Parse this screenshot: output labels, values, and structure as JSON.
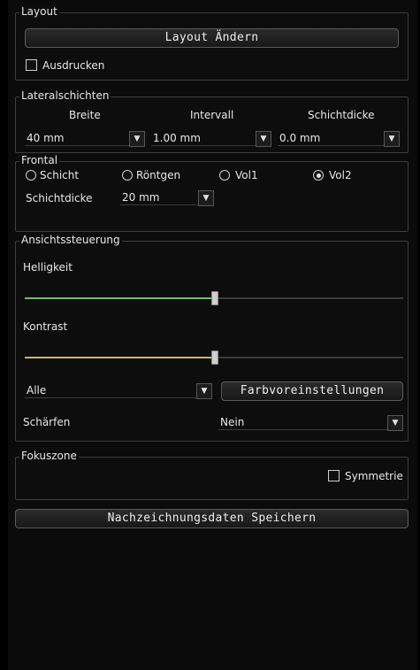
{
  "layout": {
    "title": "Layout",
    "change_button": "Layout Ändern",
    "print_label": "Ausdrucken",
    "print_checked": false
  },
  "lateral": {
    "title": "Lateralschichten",
    "headers": [
      "Breite",
      "Intervall",
      "Schichtdicke"
    ],
    "values": [
      "40 mm",
      "1.00 mm",
      "0.0 mm"
    ]
  },
  "frontal": {
    "title": "Frontal",
    "options": [
      "Schicht",
      "Röntgen",
      "Vol1",
      "Vol2"
    ],
    "selected": "Vol2",
    "thickness_label": "Schichtdicke",
    "thickness_value": "20 mm"
  },
  "view": {
    "title": "Ansichtssteuerung",
    "brightness_label": "Helligkeit",
    "brightness_value": 0.5,
    "brightness_color": "#78b878",
    "contrast_label": "Kontrast",
    "contrast_value": 0.5,
    "contrast_color": "#c9b86a",
    "filter_value": "Alle",
    "color_presets_button": "Farbvoreinstellungen",
    "sharpen_label": "Schärfen",
    "sharpen_value": "Nein"
  },
  "focus": {
    "title": "Fokuszone",
    "symmetry_label": "Symmetrie",
    "symmetry_checked": false
  },
  "save_button": "Nachzeichnungsdaten Speichern",
  "icons": {
    "dropdown": "chevron-down-icon"
  }
}
